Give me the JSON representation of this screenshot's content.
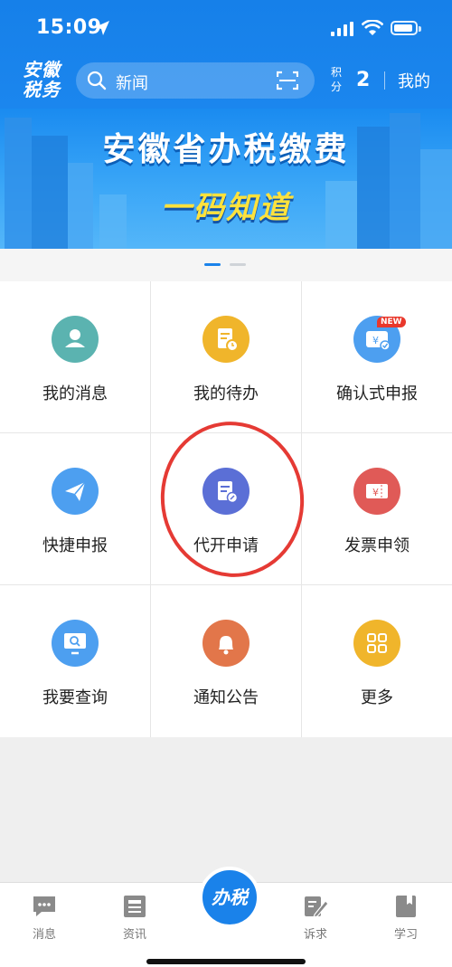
{
  "status": {
    "time": "15:09"
  },
  "header": {
    "logo": "安徽税务",
    "search_placeholder": "新闻",
    "points_label": "积分",
    "points_value": "2",
    "mine": "我的"
  },
  "banner": {
    "line1": "安徽省办税缴费",
    "line2": "一码知道"
  },
  "grid": [
    {
      "label": "我的消息",
      "icon": "user-icon",
      "color": "#5bb3b0"
    },
    {
      "label": "我的待办",
      "icon": "clock-doc-icon",
      "color": "#f0b52b"
    },
    {
      "label": "确认式申报",
      "icon": "wallet-yuan-icon",
      "color": "#4d9ff0"
    },
    {
      "label": "快捷申报",
      "icon": "paper-plane-icon",
      "color": "#4d9ff0"
    },
    {
      "label": "代开申请",
      "icon": "doc-edit-icon",
      "color": "#5b6fd6"
    },
    {
      "label": "发票申领",
      "icon": "ticket-yuan-icon",
      "color": "#e05a57"
    },
    {
      "label": "我要查询",
      "icon": "monitor-search-icon",
      "color": "#4d9ff0"
    },
    {
      "label": "通知公告",
      "icon": "bell-icon",
      "color": "#e2764a"
    },
    {
      "label": "更多",
      "icon": "grid-icon",
      "color": "#f0b52b"
    }
  ],
  "new_badge": "NEW",
  "tabbar": {
    "items": [
      {
        "label": "消息",
        "icon": "chat-icon"
      },
      {
        "label": "资讯",
        "icon": "news-icon"
      },
      {
        "label": "诉求",
        "icon": "edit-icon"
      },
      {
        "label": "学习",
        "icon": "book-icon"
      }
    ],
    "center": "办税"
  }
}
